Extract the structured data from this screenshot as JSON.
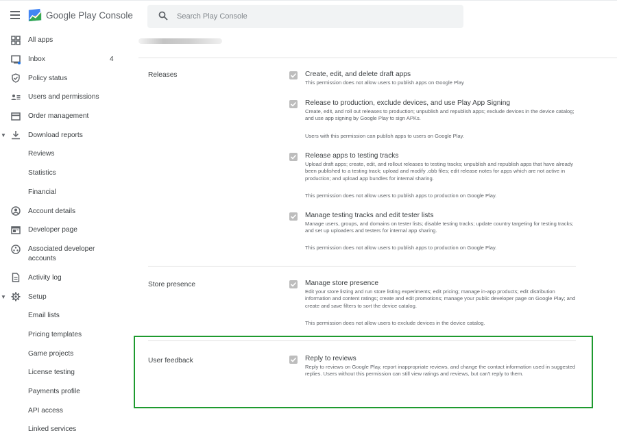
{
  "brand": {
    "title_prefix": "Google Play",
    "title_suffix": "Console"
  },
  "search": {
    "placeholder": "Search Play Console"
  },
  "sidebar": {
    "items": [
      {
        "label": "All apps",
        "icon": "grid-icon"
      },
      {
        "label": "Inbox",
        "icon": "inbox-icon",
        "count": "4"
      },
      {
        "label": "Policy status",
        "icon": "shield-icon"
      },
      {
        "label": "Users and permissions",
        "icon": "users-icon"
      },
      {
        "label": "Order management",
        "icon": "card-icon"
      },
      {
        "label": "Download reports",
        "icon": "download-icon",
        "expanded": true
      },
      {
        "label": "Reviews"
      },
      {
        "label": "Statistics"
      },
      {
        "label": "Financial"
      },
      {
        "label": "Account details",
        "icon": "account-icon"
      },
      {
        "label": "Developer page",
        "icon": "developer-page-icon"
      },
      {
        "label": "Associated developer accounts",
        "icon": "associated-accounts-icon"
      },
      {
        "label": "Activity log",
        "icon": "document-icon"
      },
      {
        "label": "Setup",
        "icon": "gear-icon",
        "expanded": true
      },
      {
        "label": "Email lists"
      },
      {
        "label": "Pricing templates"
      },
      {
        "label": "Game projects"
      },
      {
        "label": "License testing"
      },
      {
        "label": "Payments profile"
      },
      {
        "label": "API access"
      },
      {
        "label": "Linked services"
      }
    ]
  },
  "sections": {
    "releases": {
      "label": "Releases",
      "perms": [
        {
          "title": "Create, edit, and delete draft apps",
          "desc": "This permission does not allow users to publish apps on Google Play",
          "checked": true
        },
        {
          "title": "Release to production, exclude devices, and use Play App Signing",
          "desc": "Create, edit, and roll out releases to production; unpublish and republish apps; exclude devices in the device catalog; and use app signing by Google Play to sign APKs.",
          "note": "Users with this permission can publish apps to users on Google Play.",
          "checked": true
        },
        {
          "title": "Release apps to testing tracks",
          "desc": "Upload draft apps; create, edit, and rollout releases to testing tracks; unpublish and republish apps that have already been published to a testing track; upload and modify .obb files; edit release notes for apps which are not active in production; and upload app bundles for internal sharing.",
          "note": "This permission does not allow users to publish apps to production on Google Play.",
          "checked": true
        },
        {
          "title": "Manage testing tracks and edit tester lists",
          "desc": "Manage users, groups, and domains on tester lists; disable testing tracks; update country targeting for testing tracks; and set up uploaders and testers for internal app sharing.",
          "note": "This permission does not allow users to publish apps to production on Google Play.",
          "checked": true
        }
      ]
    },
    "store": {
      "label": "Store presence",
      "perms": [
        {
          "title": "Manage store presence",
          "desc": "Edit your store listing and run store listing experiments; edit pricing; manage in-app products; edit distribution information and content ratings; create and edit promotions; manage your public developer page on Google Play; and create and save filters to sort the device catalog.",
          "note": "This permission does not allow users to exclude devices in the device catalog.",
          "checked": true
        }
      ]
    },
    "feedback": {
      "label": "User feedback",
      "perms": [
        {
          "title": "Reply to reviews",
          "desc": "Reply to reviews on Google Play, report inappropriate reviews, and change the contact information used in suggested replies. Users without this permission can still view ratings and reviews, but can't reply to them.",
          "checked": true
        }
      ]
    }
  },
  "colors": {
    "highlight": "#1e9a2f",
    "checkbox": "#bdbdbd"
  }
}
